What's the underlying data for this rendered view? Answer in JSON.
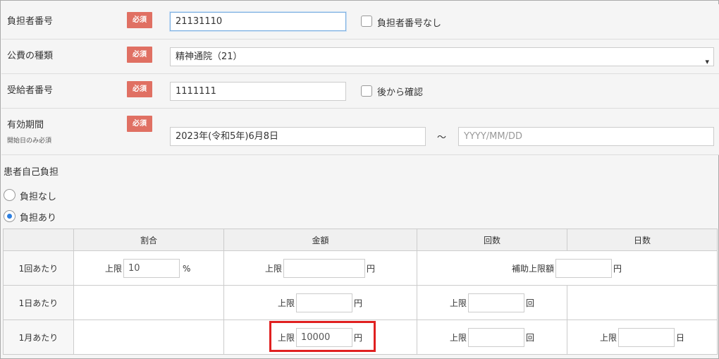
{
  "form": {
    "required_badge": "必須",
    "insurer_number": {
      "label": "負担者番号",
      "value": "21131110",
      "checkbox_label": "負担者番号なし"
    },
    "public_expense_type": {
      "label": "公費の種類",
      "selected": "精神通院（21）"
    },
    "recipient_number": {
      "label": "受給者番号",
      "value": "1111111",
      "checkbox_label": "後から確認"
    },
    "validity_period": {
      "label": "有効期間",
      "sublabel": "開始日のみ必須",
      "start": "2023年(令和5年)6月8日",
      "separator": "～",
      "end_placeholder": "YYYY/MM/DD"
    },
    "copay": {
      "label": "患者自己負担",
      "options": [
        "負担なし",
        "負担あり"
      ],
      "selected": "負担あり"
    }
  },
  "grid": {
    "headers": [
      "割合",
      "金額",
      "回数",
      "日数"
    ],
    "rows": [
      "1回あたり",
      "1日あたり",
      "1月あたり"
    ],
    "upper_limit": "上限",
    "subsidy_limit": "補助上限額",
    "unit_percent": "%",
    "unit_yen": "円",
    "unit_times": "回",
    "unit_days": "日",
    "per_visit_rate": "10",
    "per_month_amount": "10000"
  }
}
